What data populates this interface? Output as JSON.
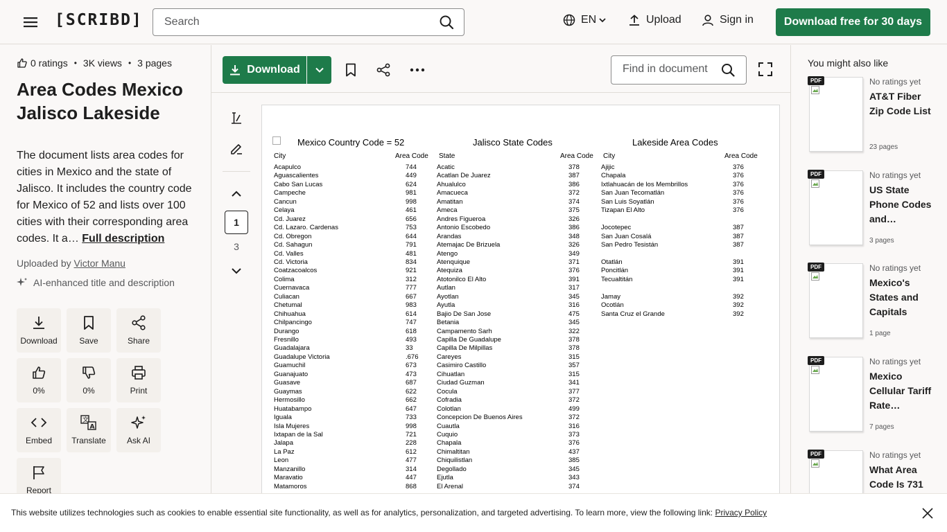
{
  "header": {
    "logo": "[SCRIBD]",
    "search_placeholder": "Search",
    "language": "EN",
    "upload": "Upload",
    "sign_in": "Sign in",
    "cta": "Download free for 30 days"
  },
  "document": {
    "ratings": "0 ratings",
    "views": "3K views",
    "pages": "3 pages",
    "title": "Area Codes Mexico Jalisco Lakeside",
    "description": "The document lists area codes for cities in Mexico and the state of Jalisco. It includes the country code for Mexico of 52 and lists over 100 cities with their corresponding area codes. It a…",
    "full_description": "Full description",
    "uploaded_by_label": "Uploaded by",
    "uploader": "Victor Manu",
    "ai_note": "AI-enhanced title and description"
  },
  "actions": [
    {
      "label": "Download"
    },
    {
      "label": "Save"
    },
    {
      "label": "Share"
    },
    {
      "label": "0%"
    },
    {
      "label": "0%"
    },
    {
      "label": "Print"
    },
    {
      "label": "Embed"
    },
    {
      "label": "Translate"
    },
    {
      "label": "Ask AI"
    },
    {
      "label": "Report"
    }
  ],
  "toolbar": {
    "download": "Download",
    "find_placeholder": "Find in document"
  },
  "pager": {
    "current": "1",
    "next": "3"
  },
  "page": {
    "mexico": {
      "title": "Mexico Country Code = 52",
      "col_city": "City",
      "col_code": "Area Code",
      "rows": [
        {
          "c": "Acapulco",
          "n": "744"
        },
        {
          "c": "Aguascalientes",
          "n": "449"
        },
        {
          "c": "Cabo San Lucas",
          "n": "624"
        },
        {
          "c": "Campeche",
          "n": "981"
        },
        {
          "c": "Cancun",
          "n": "998"
        },
        {
          "c": "Celaya",
          "n": "461"
        },
        {
          "c": "Cd. Juarez",
          "n": "656"
        },
        {
          "c": "Cd. Lazaro. Cardenas",
          "n": "753"
        },
        {
          "c": "Cd. Obregon",
          "n": "644"
        },
        {
          "c": "Cd. Sahagun",
          "n": "791"
        },
        {
          "c": "Cd. Valles",
          "n": "481"
        },
        {
          "c": "Cd. Victoria",
          "n": "834"
        },
        {
          "c": "Coatzacoalcos",
          "n": "921"
        },
        {
          "c": "Colima",
          "n": "312"
        },
        {
          "c": "Cuernavaca",
          "n": "777"
        },
        {
          "c": "Culiacan",
          "n": "667"
        },
        {
          "c": "Chetumal",
          "n": "983"
        },
        {
          "c": "Chihuahua",
          "n": "614"
        },
        {
          "c": "Chilpancingo",
          "n": "747"
        },
        {
          "c": "Durango",
          "n": "618"
        },
        {
          "c": "Fresnillo",
          "n": "493"
        },
        {
          "c": "Guadalajara",
          "n": "33"
        },
        {
          "c": "Guadalupe Victoria",
          "n": ".676"
        },
        {
          "c": "Guamuchil",
          "n": "673"
        },
        {
          "c": "Guanajuato",
          "n": "473"
        },
        {
          "c": "Guasave",
          "n": "687"
        },
        {
          "c": "Guaymas",
          "n": "622"
        },
        {
          "c": "Hermosillo",
          "n": "662"
        },
        {
          "c": "Huatabampo",
          "n": "647"
        },
        {
          "c": "Iguala",
          "n": "733"
        },
        {
          "c": "Isla Mujeres",
          "n": "998"
        },
        {
          "c": "Ixtapan de la Sal",
          "n": "721"
        },
        {
          "c": "Jalapa",
          "n": "228"
        },
        {
          "c": "La Paz",
          "n": "612"
        },
        {
          "c": "Leon",
          "n": "477"
        },
        {
          "c": "Manzanillo",
          "n": "314"
        },
        {
          "c": "Maravatio",
          "n": "447"
        },
        {
          "c": "Matamoros",
          "n": "868"
        }
      ]
    },
    "jalisco": {
      "title": "Jalisco State Codes",
      "col_city": "State",
      "col_code": "Area Code",
      "rows": [
        {
          "c": "Acatic",
          "n": "378"
        },
        {
          "c": "Acatlan De Juarez",
          "n": "387"
        },
        {
          "c": "Ahualulco",
          "n": "386"
        },
        {
          "c": "Amacueca",
          "n": "372"
        },
        {
          "c": "Amatitan",
          "n": "374"
        },
        {
          "c": "Ameca",
          "n": "375"
        },
        {
          "c": "Andres Figueroa",
          "n": "326"
        },
        {
          "c": "Antonio Escobedo",
          "n": "386"
        },
        {
          "c": "Arandas",
          "n": "348"
        },
        {
          "c": "Atemajac De Brizuela",
          "n": "326"
        },
        {
          "c": "Atengo",
          "n": "349"
        },
        {
          "c": "Atenquique",
          "n": "371"
        },
        {
          "c": "Atequiza",
          "n": "376"
        },
        {
          "c": "Atotonilco El Alto",
          "n": "391"
        },
        {
          "c": "Autlan",
          "n": "317"
        },
        {
          "c": "Ayotlan",
          "n": "345"
        },
        {
          "c": "Ayutla",
          "n": "316"
        },
        {
          "c": "Bajio De San Jose",
          "n": "475"
        },
        {
          "c": "Betania",
          "n": "345"
        },
        {
          "c": "Campamento Sarh",
          "n": "322"
        },
        {
          "c": "Capilla De Guadalupe",
          "n": "378"
        },
        {
          "c": "Capilla De Milpillas",
          "n": "378"
        },
        {
          "c": "Careyes",
          "n": "315"
        },
        {
          "c": "Casimiro Castillo",
          "n": "357"
        },
        {
          "c": "Cihuatlan",
          "n": "315"
        },
        {
          "c": "Ciudad Guzman",
          "n": "341"
        },
        {
          "c": "Cocula",
          "n": "377"
        },
        {
          "c": "Cofradia",
          "n": "372"
        },
        {
          "c": "Colotlan",
          "n": "499"
        },
        {
          "c": "Concepcion De Buenos Aires",
          "n": "372"
        },
        {
          "c": "Cuautla",
          "n": "316"
        },
        {
          "c": "Cuquio",
          "n": "373"
        },
        {
          "c": "Chapala",
          "n": "376"
        },
        {
          "c": "Chimaltitan",
          "n": "437"
        },
        {
          "c": "Chiquilistlan",
          "n": "385"
        },
        {
          "c": "Degollado",
          "n": "345"
        },
        {
          "c": "Ejutla",
          "n": "343"
        },
        {
          "c": "El Arenal",
          "n": "374"
        }
      ]
    },
    "lakeside": {
      "title": "Lakeside Area Codes",
      "col_city": "City",
      "col_code": "Area Code",
      "rows": [
        {
          "c": "Ajijic",
          "n": "376"
        },
        {
          "c": "Chapala",
          "n": "376"
        },
        {
          "c": "Ixtlahuacán de los Membrillos",
          "n": "376"
        },
        {
          "c": "San Juan Tecomatlán",
          "n": "376"
        },
        {
          "c": "San Luis Soyatlán",
          "n": "376"
        },
        {
          "c": "Tizapan El Alto",
          "n": "376"
        },
        {
          "c": "",
          "n": ""
        },
        {
          "c": "Jocotepec",
          "n": "387"
        },
        {
          "c": "San Juan Cosalá",
          "n": "387"
        },
        {
          "c": "San Pedro Tesistán",
          "n": "387"
        },
        {
          "c": "",
          "n": ""
        },
        {
          "c": "Otatlán",
          "n": "391"
        },
        {
          "c": "Poncitlán",
          "n": "391"
        },
        {
          "c": "Tecualtitán",
          "n": "391"
        },
        {
          "c": "",
          "n": ""
        },
        {
          "c": "Jamay",
          "n": "392"
        },
        {
          "c": "Ocotlán",
          "n": "392"
        },
        {
          "c": "Santa Cruz el Grande",
          "n": "392"
        }
      ]
    }
  },
  "related": {
    "heading": "You might also like",
    "items": [
      {
        "badge": "PDF",
        "rating": "No ratings yet",
        "title": "AT&T Fiber Zip Code List",
        "pages": "23 pages"
      },
      {
        "badge": "PDF",
        "rating": "No ratings yet",
        "title": "US State Phone Codes and…",
        "pages": "3 pages"
      },
      {
        "badge": "PDF",
        "rating": "No ratings yet",
        "title": "Mexico's States and Capitals",
        "pages": "1 page"
      },
      {
        "badge": "PDF",
        "rating": "No ratings yet",
        "title": "Mexico Cellular Tariff Rate…",
        "pages": "7 pages"
      },
      {
        "badge": "PDF",
        "rating": "No ratings yet",
        "title": "What Area Code Is 731",
        "pages": ""
      }
    ]
  },
  "cookie": {
    "text": "This website utilizes technologies such as cookies to enable essential site functionality, as well as for analytics, personalization, and targeted advertising. To learn more, view the following link: ",
    "link": "Privacy Policy"
  },
  "colors": {
    "brand_green": "#1e7b4a",
    "background": "#faf8f7"
  }
}
